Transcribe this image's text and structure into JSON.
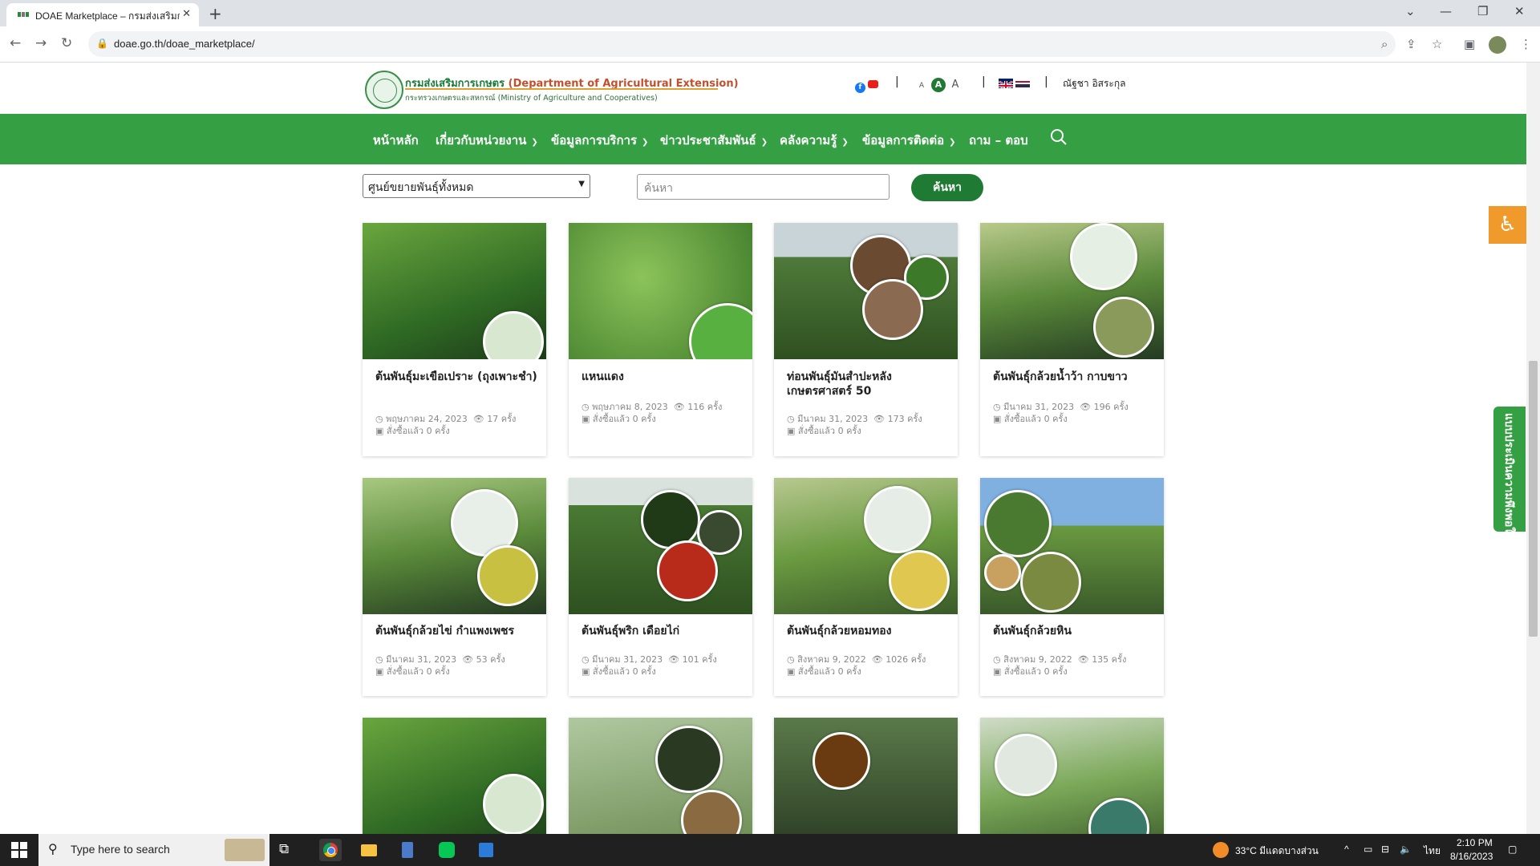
{
  "browser": {
    "tab_title": "DOAE Marketplace – กรมส่งเสริมก",
    "url": "doae.go.th/doae_marketplace/"
  },
  "header": {
    "org_name_th": "กรมส่งเสริมการเกษตร",
    "org_name_en": "(Department of Agricultural Extension)",
    "ministry": "กระทรวงเกษตรและสหกรณ์ (Ministry of Agriculture and Cooperatives)",
    "font_sizes": [
      "A",
      "A",
      "A"
    ],
    "user_name": "ณัฐชา อิสระกุล"
  },
  "nav": {
    "items": [
      {
        "label": "หน้าหลัก",
        "dropdown": false
      },
      {
        "label": "เกี่ยวกับหน่วยงาน",
        "dropdown": true
      },
      {
        "label": "ข้อมูลการบริการ",
        "dropdown": true
      },
      {
        "label": "ข่าวประชาสัมพันธ์",
        "dropdown": true
      },
      {
        "label": "คลังความรู้",
        "dropdown": true
      },
      {
        "label": "ข้อมูลการติดต่อ",
        "dropdown": true
      },
      {
        "label": "ถาม – ตอบ",
        "dropdown": false
      }
    ]
  },
  "filter": {
    "center_select": "ศูนย์ขยายพันธุ์ทั้งหมด",
    "search_placeholder": "ค้นหา",
    "search_button": "ค้นหา"
  },
  "products": [
    {
      "name": "ต้นพันธุ์มะเขือเปราะ (ถุงเพาะชำ)",
      "date": "พฤษภาคม 24, 2023",
      "views": "17 ครั้ง",
      "sold": "สั่งซื้อแล้ว 0 ครั้ง"
    },
    {
      "name": "แหนแดง",
      "date": "พฤษภาคม 8, 2023",
      "views": "116 ครั้ง",
      "sold": "สั่งซื้อแล้ว 0 ครั้ง"
    },
    {
      "name": "ท่อนพันธุ์มันสำปะหลัง เกษตรศาสตร์ 50",
      "date": "มีนาคม 31, 2023",
      "views": "173 ครั้ง",
      "sold": "สั่งซื้อแล้ว 0 ครั้ง"
    },
    {
      "name": "ต้นพันธุ์กล้วยน้ำว้า กาบขาว",
      "date": "มีนาคม 31, 2023",
      "views": "196 ครั้ง",
      "sold": "สั่งซื้อแล้ว 0 ครั้ง"
    },
    {
      "name": "ต้นพันธุ์กล้วยไข่ กำแพงเพชร",
      "date": "มีนาคม 31, 2023",
      "views": "53 ครั้ง",
      "sold": "สั่งซื้อแล้ว 0 ครั้ง"
    },
    {
      "name": "ต้นพันธุ์พริก เดือยไก่",
      "date": "มีนาคม 31, 2023",
      "views": "101 ครั้ง",
      "sold": "สั่งซื้อแล้ว 0 ครั้ง"
    },
    {
      "name": "ต้นพันธุ์กล้วยหอมทอง",
      "date": "สิงหาคม 9, 2022",
      "views": "1026 ครั้ง",
      "sold": "สั่งซื้อแล้ว 0 ครั้ง"
    },
    {
      "name": "ต้นพันธุ์กล้วยหิน",
      "date": "สิงหาคม 9, 2022",
      "views": "135 ครั้ง",
      "sold": "สั่งซื้อแล้ว 0 ครั้ง"
    }
  ],
  "side": {
    "survey_label": "แบบประเมินความพึงพอใจ"
  },
  "taskbar": {
    "search_text": "Type here to search",
    "weather": "33°C มีแดดบางส่วน",
    "lang": "ไทย",
    "time": "2:10 PM",
    "date": "8/16/2023"
  },
  "colors": {
    "nav_green": "#34a043",
    "button_dark_green": "#1f7a33",
    "accessibility_orange": "#f19a2c"
  }
}
